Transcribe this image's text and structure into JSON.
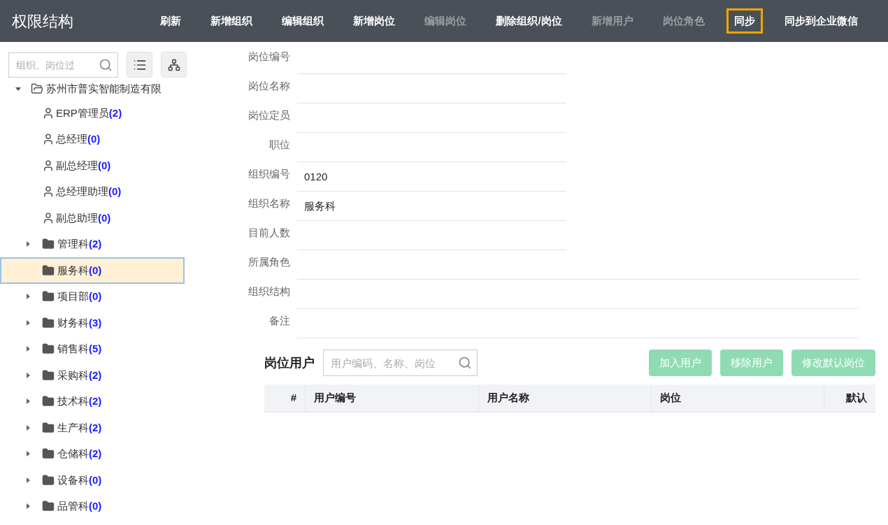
{
  "app_title": "权限结构",
  "toolbar": [
    {
      "label": "刷新",
      "disabled": false,
      "selected": false
    },
    {
      "label": "新增组织",
      "disabled": false,
      "selected": false
    },
    {
      "label": "编辑组织",
      "disabled": false,
      "selected": false
    },
    {
      "label": "新增岗位",
      "disabled": false,
      "selected": false
    },
    {
      "label": "编辑岗位",
      "disabled": true,
      "selected": false
    },
    {
      "label": "删除组织/岗位",
      "disabled": false,
      "selected": false
    },
    {
      "label": "新增用户",
      "disabled": true,
      "selected": false
    },
    {
      "label": "岗位角色",
      "disabled": true,
      "selected": false
    },
    {
      "label": "同步",
      "disabled": false,
      "selected": true
    },
    {
      "label": "同步到企业微信",
      "disabled": false,
      "selected": false
    }
  ],
  "tree_search": {
    "placeholder": "组织、岗位过"
  },
  "tree": [
    {
      "label": "苏州市普实智能制造有限",
      "kind": "folder",
      "expanded": true,
      "children": [
        {
          "label": "ERP管理员",
          "count": "(2)",
          "kind": "position",
          "selected": false
        },
        {
          "label": "总经理",
          "count": "(0)",
          "kind": "position",
          "selected": false
        },
        {
          "label": "副总经理",
          "count": "(0)",
          "kind": "position",
          "selected": false
        },
        {
          "label": "总经理助理",
          "count": "(0)",
          "kind": "position",
          "selected": false
        },
        {
          "label": "副总助理",
          "count": "(0)",
          "kind": "position",
          "selected": false
        },
        {
          "label": "管理科",
          "count": "(2)",
          "kind": "folder",
          "expandable": true,
          "selected": false
        },
        {
          "label": "服务科",
          "count": "(0)",
          "kind": "folder",
          "expandable": false,
          "selected": true
        },
        {
          "label": "项目部",
          "count": "(0)",
          "kind": "folder",
          "expandable": true,
          "selected": false
        },
        {
          "label": "财务科",
          "count": "(3)",
          "kind": "folder",
          "expandable": true,
          "selected": false
        },
        {
          "label": "销售科",
          "count": "(5)",
          "kind": "folder",
          "expandable": true,
          "selected": false
        },
        {
          "label": "采购科",
          "count": "(2)",
          "kind": "folder",
          "expandable": true,
          "selected": false
        },
        {
          "label": "技术科",
          "count": "(2)",
          "kind": "folder",
          "expandable": true,
          "selected": false
        },
        {
          "label": "生产科",
          "count": "(2)",
          "kind": "folder",
          "expandable": true,
          "selected": false
        },
        {
          "label": "仓储科",
          "count": "(2)",
          "kind": "folder",
          "expandable": true,
          "selected": false
        },
        {
          "label": "设备科",
          "count": "(0)",
          "kind": "folder",
          "expandable": true,
          "selected": false
        },
        {
          "label": "品管科",
          "count": "(0)",
          "kind": "folder",
          "expandable": true,
          "selected": false
        }
      ]
    }
  ],
  "form": [
    {
      "label": "岗位编号",
      "wide": false
    },
    {
      "label": "岗位名称",
      "wide": false
    },
    {
      "label": "岗位定员",
      "wide": false
    },
    {
      "label": "职位",
      "wide": false
    },
    {
      "label": "组织编号",
      "value": "0120",
      "wide": false
    },
    {
      "label": "组织名称",
      "value": "服务科",
      "wide": false
    },
    {
      "label": "目前人数",
      "wide": false
    },
    {
      "label": "所属角色",
      "wide": true
    },
    {
      "label": "组织结构",
      "wide": true
    },
    {
      "label": "备注",
      "wide": true
    }
  ],
  "users": {
    "title": "岗位用户",
    "search_placeholder": "用户编码、名称、岗位",
    "buttons": [
      {
        "label": "加入用户",
        "disabled": true
      },
      {
        "label": "移除用户",
        "disabled": true
      },
      {
        "label": "修改默认岗位",
        "disabled": true
      }
    ],
    "columns": [
      "#",
      "用户编号",
      "用户名称",
      "岗位",
      "默认"
    ]
  }
}
